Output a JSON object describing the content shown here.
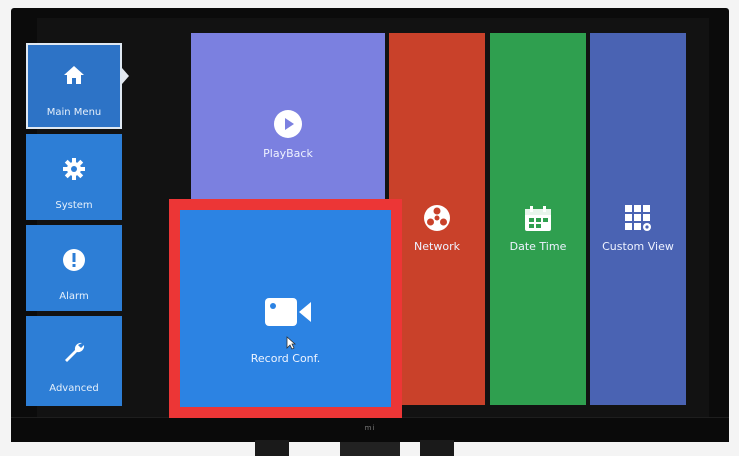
{
  "sidebar": {
    "items": [
      {
        "label": "Main Menu",
        "icon": "home-icon",
        "active": true
      },
      {
        "label": "System",
        "icon": "gear-icon",
        "active": false
      },
      {
        "label": "Alarm",
        "icon": "alert-icon",
        "active": false
      },
      {
        "label": "Advanced",
        "icon": "wrench-icon",
        "active": false
      }
    ]
  },
  "tiles": {
    "playback": {
      "label": "PlayBack",
      "icon": "play-icon",
      "color": "#7b80e0"
    },
    "network": {
      "label": "Network",
      "icon": "network-globe-icon",
      "color": "#c9412a"
    },
    "datetime": {
      "label": "Date Time",
      "icon": "calendar-icon",
      "color": "#2f9f4f"
    },
    "customview": {
      "label": "Custom View",
      "icon": "grid-settings-icon",
      "color": "#4a63b3"
    },
    "record": {
      "label": "Record Conf.",
      "icon": "video-camera-icon",
      "color": "#2c83e3",
      "highlight_color": "#ec3636"
    }
  },
  "monitor": {
    "brand": "mi"
  }
}
